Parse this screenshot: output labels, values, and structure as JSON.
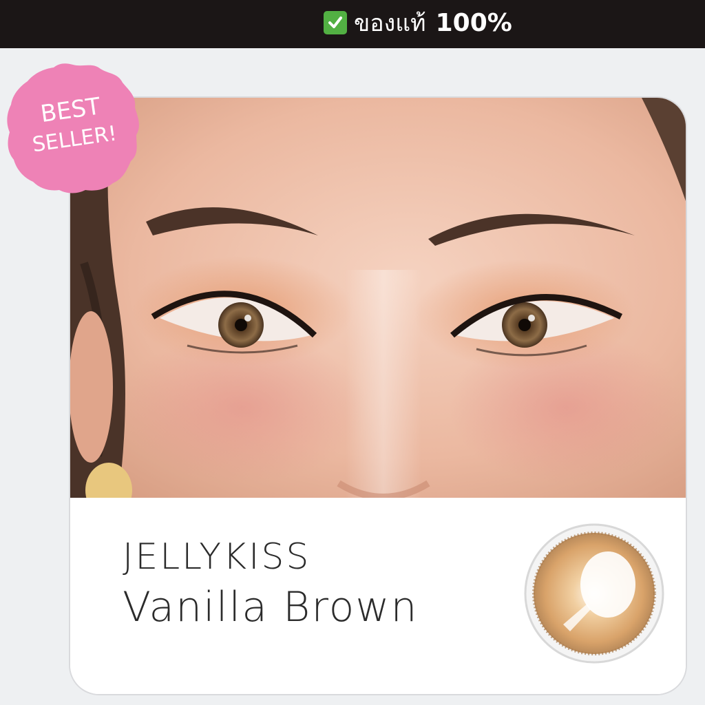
{
  "header": {
    "authentic_text": "ของแท้",
    "authentic_percent": "100%"
  },
  "badge": {
    "line1": "BEST",
    "line2": "SELLER!"
  },
  "product": {
    "brand": "JELLYKISS",
    "name": "Vanilla Brown"
  },
  "colors": {
    "topbar": "#1b1616",
    "check": "#52b043",
    "badge": "#ee82b6",
    "lens": "#d9a36a"
  }
}
